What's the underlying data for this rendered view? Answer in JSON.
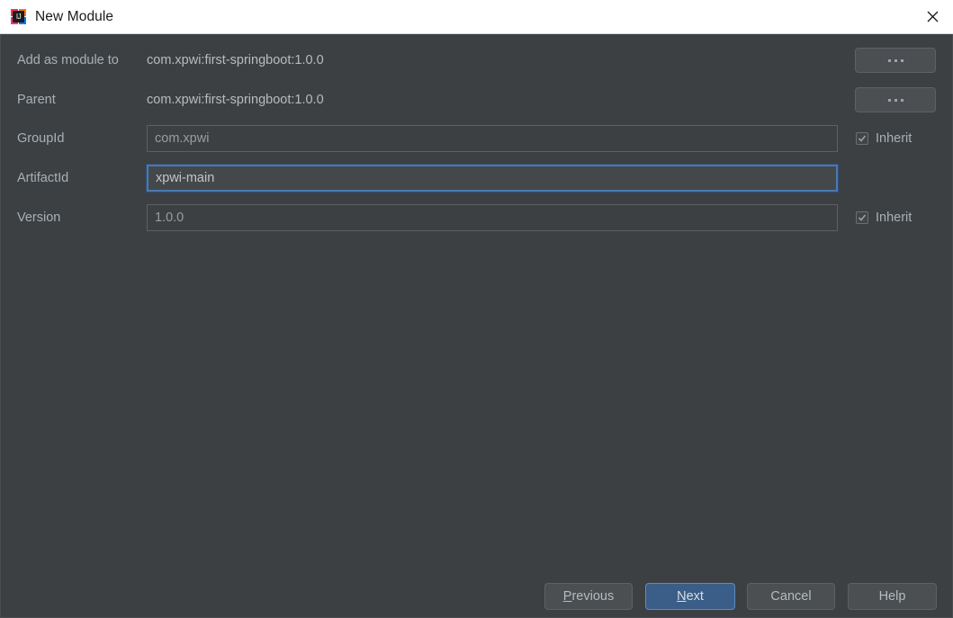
{
  "window": {
    "title": "New Module",
    "icon": "intellij-idea-icon",
    "icon_letters": "IJ",
    "close_icon": "close-icon"
  },
  "form": {
    "rows": [
      {
        "label": "Add as module to",
        "value": "com.xpwi:first-springboot:1.0.0",
        "browse_label": "..."
      },
      {
        "label": "Parent",
        "value": "com.xpwi:first-springboot:1.0.0",
        "browse_label": "..."
      }
    ],
    "fields": [
      {
        "label": "GroupId",
        "value": "com.xpwi",
        "inherit_label": "Inherit",
        "inherit_checked": true,
        "focused": false
      },
      {
        "label": "ArtifactId",
        "value": "xpwi-main",
        "inherit_label": "",
        "inherit_checked": false,
        "focused": true
      },
      {
        "label": "Version",
        "value": "1.0.0",
        "inherit_label": "Inherit",
        "inherit_checked": true,
        "focused": false
      }
    ]
  },
  "footer": {
    "previous": {
      "pre": "",
      "mnemonic": "P",
      "post": "revious"
    },
    "next": {
      "pre": "",
      "mnemonic": "N",
      "post": "ext"
    },
    "cancel": "Cancel",
    "help": "Help"
  },
  "colors": {
    "dialog_bg": "#3c4043",
    "titlebar_bg": "#ffffff",
    "accent_button": "#3a5e87",
    "focus_border": "#4a7ab0",
    "label_text": "#a9b0b4"
  }
}
